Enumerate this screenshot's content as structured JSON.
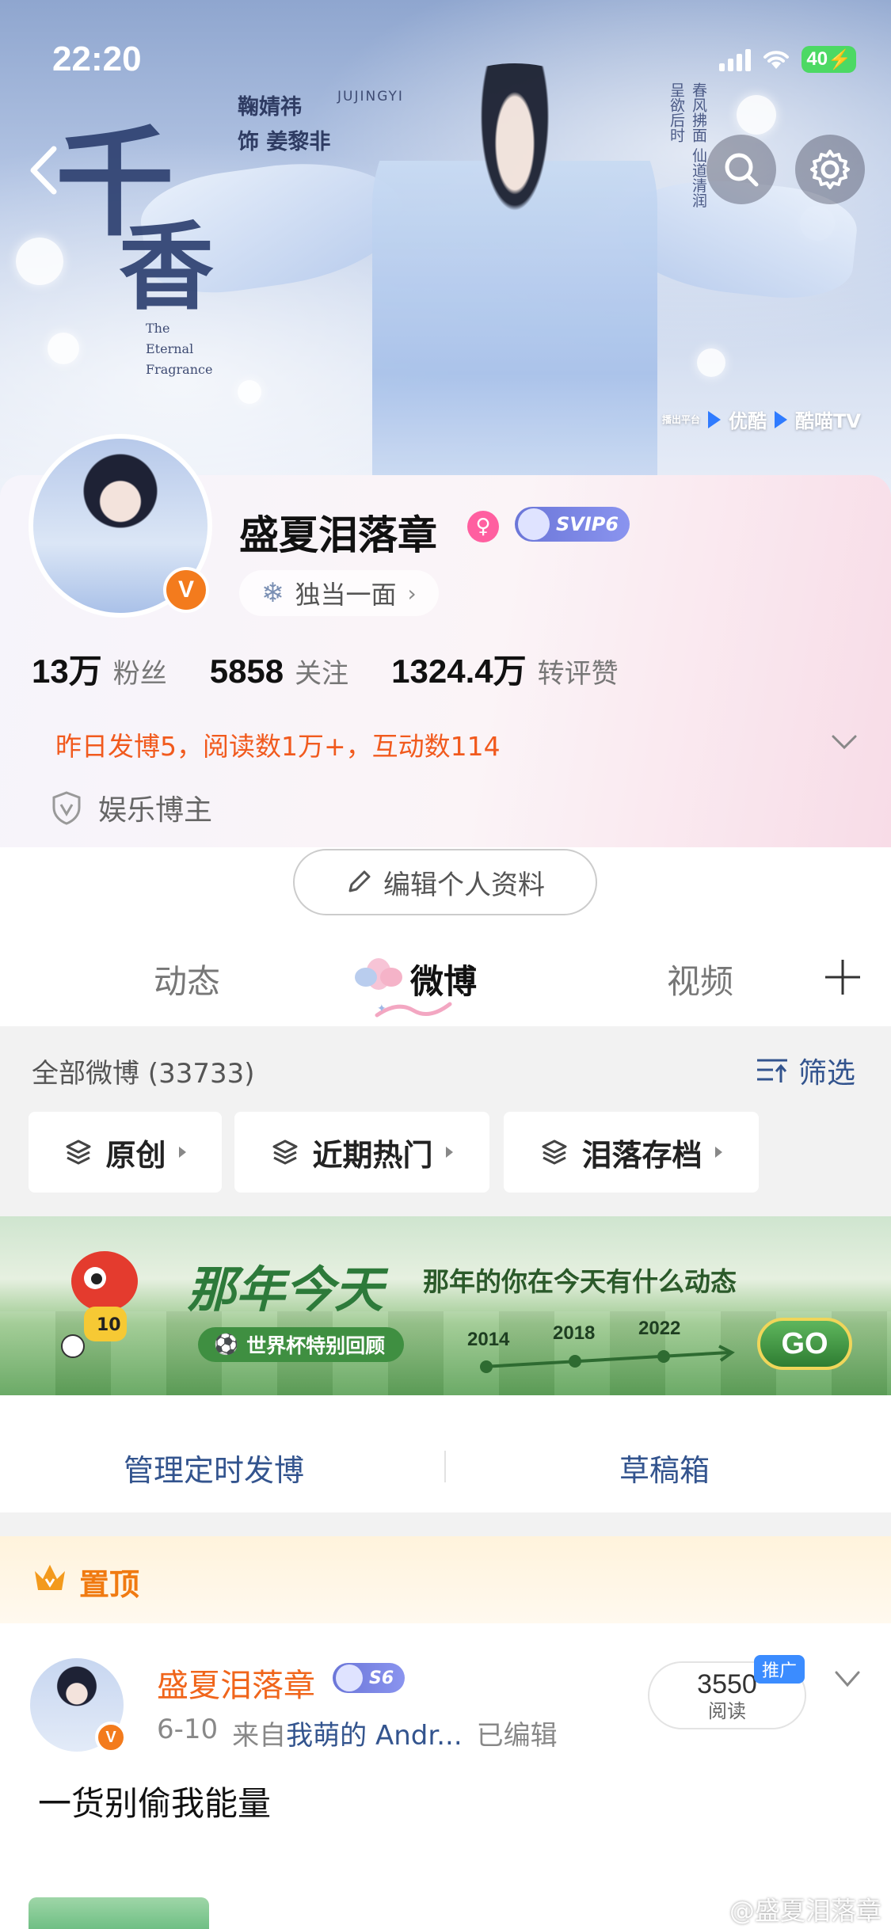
{
  "status_bar": {
    "time": "22:20",
    "battery": "40"
  },
  "banner": {
    "title_char_1": "千",
    "title_char_2": "香",
    "cast_line_1": "鞠婧祎",
    "cast_line_2": "饰 姜黎非",
    "cast_romanized": "JUJINGYI",
    "english_title": [
      "The",
      "Eternal",
      "Fragrance"
    ],
    "platform_label": "播出平台",
    "platform_1": "优酷",
    "platform_2": "酷喵TV"
  },
  "profile": {
    "username": "盛夏泪落章",
    "gender_icon": "female-icon",
    "vip_badge": "SVIP6",
    "verified_mark": "V",
    "title_pill": "独当一面",
    "stats": [
      {
        "num": "13万",
        "label": "粉丝"
      },
      {
        "num": "5858",
        "label": "关注"
      },
      {
        "num": "1324.4万",
        "label": "转评赞"
      }
    ],
    "activity": "昨日发博5，阅读数1万+，互动数114",
    "certification": "娱乐博主",
    "edit_button": "编辑个人资料"
  },
  "tabs": [
    "动态",
    "微博",
    "视频"
  ],
  "active_tab": "微博",
  "feed_header": {
    "all_weibo": "全部微博 (33733)",
    "filter": "筛选"
  },
  "chips": [
    "原创",
    "近期热门",
    "泪落存档"
  ],
  "promo": {
    "title": "那年今天",
    "subtitle": "那年的你在今天有什么动态",
    "pill": "世界杯特别回顾",
    "years": [
      "2014",
      "2018",
      "2022"
    ],
    "go": "GO",
    "jersey_number": "10"
  },
  "manage": {
    "schedule": "管理定时发博",
    "drafts": "草稿箱"
  },
  "pinned_post": {
    "pin_label": "置顶",
    "author": "盛夏泪落章",
    "vip_badge": "S6",
    "date": "6-10",
    "source_prefix": "来自",
    "source": "我萌的 Andr...",
    "edited": "已编辑",
    "reads_num": "3550",
    "reads_label": "阅读",
    "promo_tag": "推广",
    "text": "一货别偷我能量"
  },
  "watermark": "@盛夏泪落章",
  "colors": {
    "accent_orange": "#f15a1e",
    "link_blue": "#33548e",
    "vip_purple": "#6b76d8",
    "verified_orange": "#f37b1d"
  }
}
